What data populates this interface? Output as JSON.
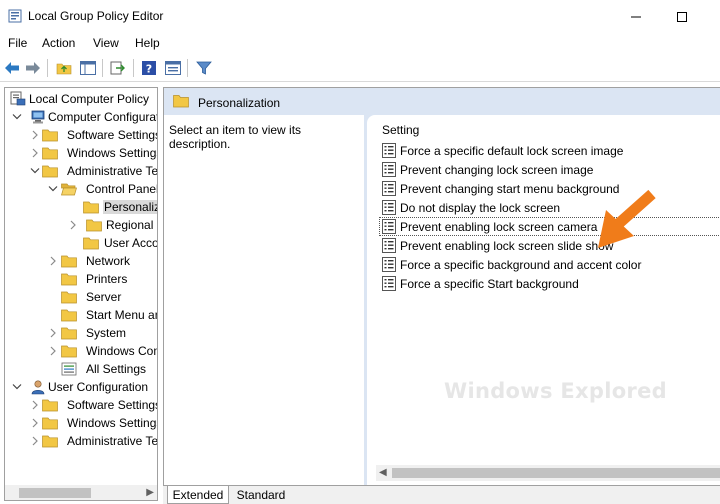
{
  "window": {
    "title": "Local Group Policy Editor"
  },
  "menu": [
    "File",
    "Action",
    "View",
    "Help"
  ],
  "tree": {
    "items": [
      {
        "label": "Local Computer Policy",
        "level": 0,
        "expander": "none",
        "icon": "policy-computer-icon"
      },
      {
        "label": "Computer Configuration",
        "level": 0,
        "expander": "expanded",
        "icon": "computer-icon"
      },
      {
        "label": "Software Settings",
        "level": 1,
        "expander": "collapsed",
        "icon": "folder-icon"
      },
      {
        "label": "Windows Settings",
        "level": 1,
        "expander": "collapsed",
        "icon": "folder-icon"
      },
      {
        "label": "Administrative Templates",
        "level": 1,
        "expander": "expanded",
        "icon": "folder-icon"
      },
      {
        "label": "Control Panel",
        "level": 2,
        "expander": "expanded",
        "icon": "folder-open-icon"
      },
      {
        "label": "Personalization",
        "level": 3,
        "expander": "none",
        "icon": "folder-icon",
        "selected": true
      },
      {
        "label": "Regional and Language Options",
        "level": 3,
        "expander": "collapsed",
        "icon": "folder-icon"
      },
      {
        "label": "User Accounts",
        "level": 3,
        "expander": "none",
        "icon": "folder-icon"
      },
      {
        "label": "Network",
        "level": 2,
        "expander": "collapsed",
        "icon": "folder-icon"
      },
      {
        "label": "Printers",
        "level": 2,
        "expander": "none",
        "icon": "folder-icon"
      },
      {
        "label": "Server",
        "level": 2,
        "expander": "none",
        "icon": "folder-icon"
      },
      {
        "label": "Start Menu and Taskbar",
        "level": 2,
        "expander": "none",
        "icon": "folder-icon"
      },
      {
        "label": "System",
        "level": 2,
        "expander": "collapsed",
        "icon": "folder-icon"
      },
      {
        "label": "Windows Components",
        "level": 2,
        "expander": "collapsed",
        "icon": "folder-icon"
      },
      {
        "label": "All Settings",
        "level": 2,
        "expander": "none",
        "icon": "all-settings-icon"
      },
      {
        "label": "User Configuration",
        "level": 0,
        "expander": "expanded",
        "icon": "user-icon"
      },
      {
        "label": "Software Settings",
        "level": 1,
        "expander": "collapsed",
        "icon": "folder-icon"
      },
      {
        "label": "Windows Settings",
        "level": 1,
        "expander": "collapsed",
        "icon": "folder-icon"
      },
      {
        "label": "Administrative Templates",
        "level": 1,
        "expander": "collapsed",
        "icon": "folder-icon"
      }
    ]
  },
  "details": {
    "header": "Personalization",
    "description": "Select an item to view its description.",
    "column_header": "Setting",
    "settings": [
      "Force a specific default lock screen image",
      "Prevent changing lock screen image",
      "Prevent changing start menu background",
      "Do not display the lock screen",
      "Prevent enabling lock screen camera",
      "Prevent enabling lock screen slide show",
      "Force a specific background and accent color",
      "Force a specific Start background"
    ],
    "focused_index": 4
  },
  "tabs": [
    "Extended",
    "Standard"
  ],
  "watermark": "Windows Explored",
  "colors": {
    "header_bg": "#dbe5f3",
    "folder": "#f2c744",
    "arrow": "#f07c1a",
    "toolbar_blue": "#2b79c2"
  }
}
